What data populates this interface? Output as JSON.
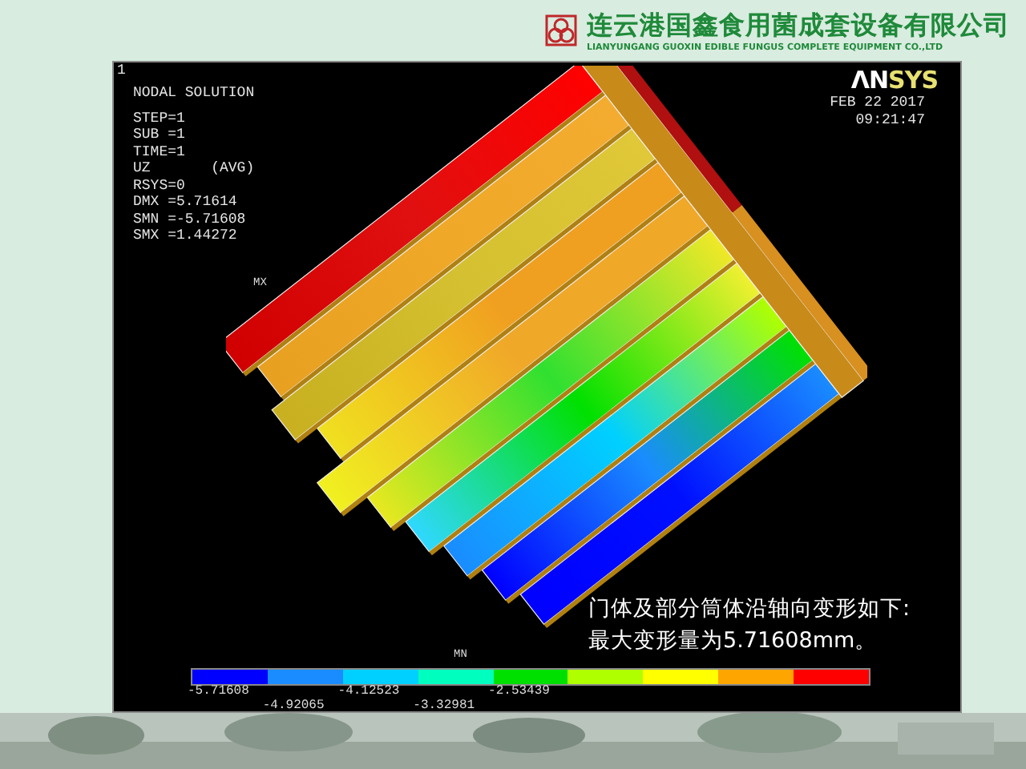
{
  "header": {
    "company_name": "连云港国鑫食用菌成套设备有限公司",
    "company_name_en": "LIANYUNGANG GUOXIN EDIBLE FUNGUS COMPLETE EQUIPMENT CO.,LTD"
  },
  "graphics_window": {
    "window_number": "1",
    "title": "NODAL SOLUTION",
    "info_lines": [
      "STEP=1",
      "SUB =1",
      "TIME=1",
      "UZ       (AVG)",
      "RSYS=0",
      "DMX =5.71614",
      "SMN =-5.71608",
      "SMX =1.44272"
    ],
    "logo_prefix": "ΛN",
    "logo_suffix": "SYS",
    "date": "FEB 22 2017",
    "time": "09:21:47",
    "markers": {
      "max": "MX",
      "min": "MN"
    },
    "caption": [
      "门体及部分筒体沿轴向变形如下:",
      "最大变形量为5.71608mm。"
    ],
    "legend": {
      "colors": [
        {
          "color": "#0000ff"
        },
        {
          "color": "#1a8cff"
        },
        {
          "color": "#00d0ff"
        },
        {
          "color": "#00ffbf"
        },
        {
          "color": "#00e000"
        },
        {
          "color": "#b0ff00"
        },
        {
          "color": "#ffff00"
        },
        {
          "color": "#ffa500"
        },
        {
          "color": "#ff0000"
        }
      ],
      "labels": [
        "-5.71608",
        "-4.92065",
        "-4.12523",
        "-3.32981",
        "-2.53439"
      ]
    }
  }
}
